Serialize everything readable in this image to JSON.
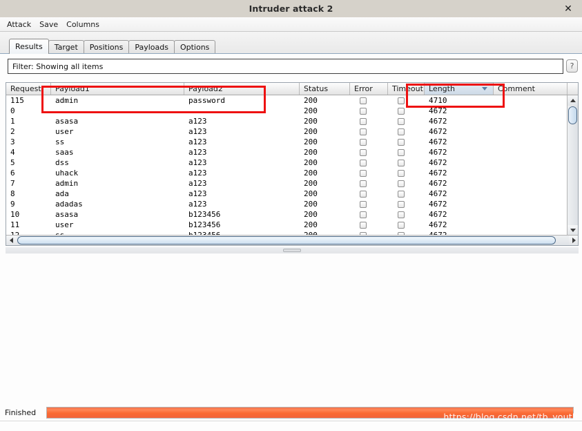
{
  "window": {
    "title": "Intruder attack 2",
    "close_icon": "close-icon",
    "close_label": "✕"
  },
  "menubar": {
    "items": [
      {
        "label": "Attack"
      },
      {
        "label": "Save"
      },
      {
        "label": "Columns"
      }
    ]
  },
  "tabs": [
    {
      "label": "Results",
      "active": true
    },
    {
      "label": "Target",
      "active": false
    },
    {
      "label": "Positions",
      "active": false
    },
    {
      "label": "Payloads",
      "active": false
    },
    {
      "label": "Options",
      "active": false
    }
  ],
  "filter": {
    "text": "Filter: Showing all items",
    "help_label": "?"
  },
  "table": {
    "columns": [
      {
        "label": "Request",
        "width": 65,
        "sorted": false
      },
      {
        "label": "Payload1",
        "width": 193,
        "sorted": false
      },
      {
        "label": "Payload2",
        "width": 167,
        "sorted": false
      },
      {
        "label": "Status",
        "width": 73,
        "sorted": false
      },
      {
        "label": "Error",
        "width": 55,
        "sorted": false
      },
      {
        "label": "Timeout",
        "width": 53,
        "sorted": false
      },
      {
        "label": "Length",
        "width": 100,
        "sorted": true,
        "sort_direction": "desc"
      },
      {
        "label": "Comment",
        "width": 107,
        "sorted": false
      }
    ],
    "rows": [
      {
        "request": "115",
        "payload1": "admin",
        "payload2": "password",
        "status": "200",
        "error": false,
        "timeout": false,
        "length": "4710",
        "comment": ""
      },
      {
        "request": "0",
        "payload1": "",
        "payload2": "",
        "status": "200",
        "error": false,
        "timeout": false,
        "length": "4672",
        "comment": ""
      },
      {
        "request": "1",
        "payload1": "asasa",
        "payload2": "a123",
        "status": "200",
        "error": false,
        "timeout": false,
        "length": "4672",
        "comment": ""
      },
      {
        "request": "2",
        "payload1": "user",
        "payload2": "a123",
        "status": "200",
        "error": false,
        "timeout": false,
        "length": "4672",
        "comment": ""
      },
      {
        "request": "3",
        "payload1": "ss",
        "payload2": "a123",
        "status": "200",
        "error": false,
        "timeout": false,
        "length": "4672",
        "comment": ""
      },
      {
        "request": "4",
        "payload1": "saas",
        "payload2": "a123",
        "status": "200",
        "error": false,
        "timeout": false,
        "length": "4672",
        "comment": ""
      },
      {
        "request": "5",
        "payload1": "dss",
        "payload2": "a123",
        "status": "200",
        "error": false,
        "timeout": false,
        "length": "4672",
        "comment": ""
      },
      {
        "request": "6",
        "payload1": "uhack",
        "payload2": "a123",
        "status": "200",
        "error": false,
        "timeout": false,
        "length": "4672",
        "comment": ""
      },
      {
        "request": "7",
        "payload1": "admin",
        "payload2": "a123",
        "status": "200",
        "error": false,
        "timeout": false,
        "length": "4672",
        "comment": ""
      },
      {
        "request": "8",
        "payload1": "ada",
        "payload2": "a123",
        "status": "200",
        "error": false,
        "timeout": false,
        "length": "4672",
        "comment": ""
      },
      {
        "request": "9",
        "payload1": "adadas",
        "payload2": "a123",
        "status": "200",
        "error": false,
        "timeout": false,
        "length": "4672",
        "comment": ""
      },
      {
        "request": "10",
        "payload1": "asasa",
        "payload2": "b123456",
        "status": "200",
        "error": false,
        "timeout": false,
        "length": "4672",
        "comment": ""
      },
      {
        "request": "11",
        "payload1": "user",
        "payload2": "b123456",
        "status": "200",
        "error": false,
        "timeout": false,
        "length": "4672",
        "comment": ""
      },
      {
        "request": "12",
        "payload1": "ss",
        "payload2": "b123456",
        "status": "200",
        "error": false,
        "timeout": false,
        "length": "4672",
        "comment": ""
      }
    ]
  },
  "status": {
    "label": "Finished",
    "progress_percent": 100
  },
  "watermark": {
    "text": "https://blog.csdn.net/tb_youth"
  },
  "annotations": {
    "payload_box_color": "#ee1111",
    "length_box_color": "#ee1111"
  },
  "colors": {
    "titlebar_bg": "#d6d2ca",
    "progress_fill": "#fa6a33",
    "sorted_header_bg": "#ccd9e6"
  }
}
